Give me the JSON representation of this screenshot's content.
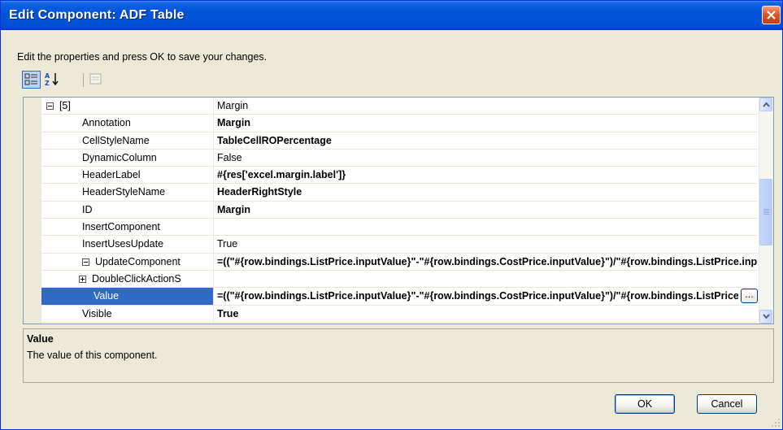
{
  "window": {
    "title": "Edit Component: ADF Table",
    "close_icon": "close-icon"
  },
  "intro": "Edit the properties and press OK to save your changes.",
  "toolbar": {
    "categorized_icon": "categorized-view-icon",
    "alphabetical_icon": "alphabetical-sort-icon",
    "property_pages_icon": "property-pages-icon"
  },
  "grid": {
    "rows": [
      {
        "name": "[5]",
        "value": "Margin",
        "expander": "minus",
        "indent": 0,
        "bold": false
      },
      {
        "name": "Annotation",
        "value": "Margin",
        "indent": 1,
        "bold": true
      },
      {
        "name": "CellStyleName",
        "value": "TableCellROPercentage",
        "indent": 1,
        "bold": true
      },
      {
        "name": "DynamicColumn",
        "value": "False",
        "indent": 1,
        "bold": false
      },
      {
        "name": "HeaderLabel",
        "value": "#{res['excel.margin.label']}",
        "indent": 1,
        "bold": true
      },
      {
        "name": "HeaderStyleName",
        "value": "HeaderRightStyle",
        "indent": 1,
        "bold": true
      },
      {
        "name": "ID",
        "value": "Margin",
        "indent": 1,
        "bold": true
      },
      {
        "name": "InsertComponent",
        "value": "",
        "indent": 1,
        "bold": false
      },
      {
        "name": "InsertUsesUpdate",
        "value": "True",
        "indent": 1,
        "bold": false
      },
      {
        "name": "UpdateComponent",
        "value": "=((\"#{row.bindings.ListPrice.inputValue}\"-\"#{row.bindings.CostPrice.inputValue}\")/\"#{row.bindings.ListPrice.inputValue}\")",
        "expander": "minus",
        "indent": 1,
        "bold": true
      },
      {
        "name": "DoubleClickActionS",
        "value": "",
        "expander": "plus",
        "indent": 2,
        "bold": false
      },
      {
        "name": "Value",
        "value": "=((\"#{row.bindings.ListPrice.inputValue}\"-\"#{row.bindings.CostPrice.inputValue}\")/\"#{row.bindings.ListPrice.inputValue}\")",
        "indent": 2,
        "bold": true,
        "selected": true
      },
      {
        "name": "Visible",
        "value": "True",
        "indent": 1,
        "bold": true
      }
    ],
    "ellipsis_label": "..."
  },
  "help": {
    "title": "Value",
    "description": "The value of this component."
  },
  "buttons": {
    "ok": "OK",
    "cancel": "Cancel"
  },
  "colors": {
    "title_bar": "#0054e3",
    "selection": "#316ac5",
    "dialog_bg": "#ece9d8"
  }
}
